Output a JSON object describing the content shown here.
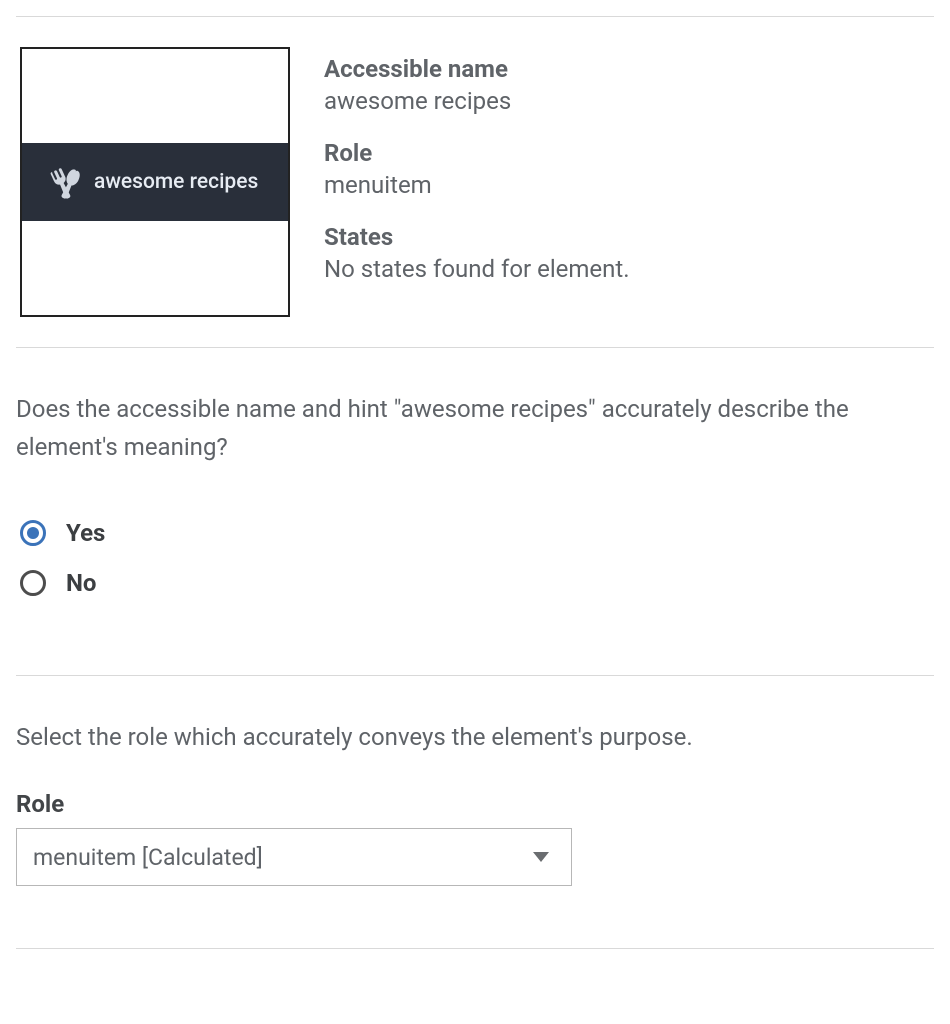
{
  "element_preview": {
    "nav_item_text": "awesome recipes"
  },
  "details": {
    "accessible_name_label": "Accessible name",
    "accessible_name_value": "awesome recipes",
    "role_label": "Role",
    "role_value": "menuitem",
    "states_label": "States",
    "states_value": "No states found for element."
  },
  "question1": {
    "text": "Does the accessible name and hint \"awesome recipes\" accurately describe the element's meaning?",
    "options": {
      "yes": "Yes",
      "no": "No"
    },
    "selected": "yes"
  },
  "question2": {
    "text": "Select the role which accurately conveys the element's purpose.",
    "role_field_label": "Role",
    "dropdown_selected": "menuitem [Calculated]"
  }
}
